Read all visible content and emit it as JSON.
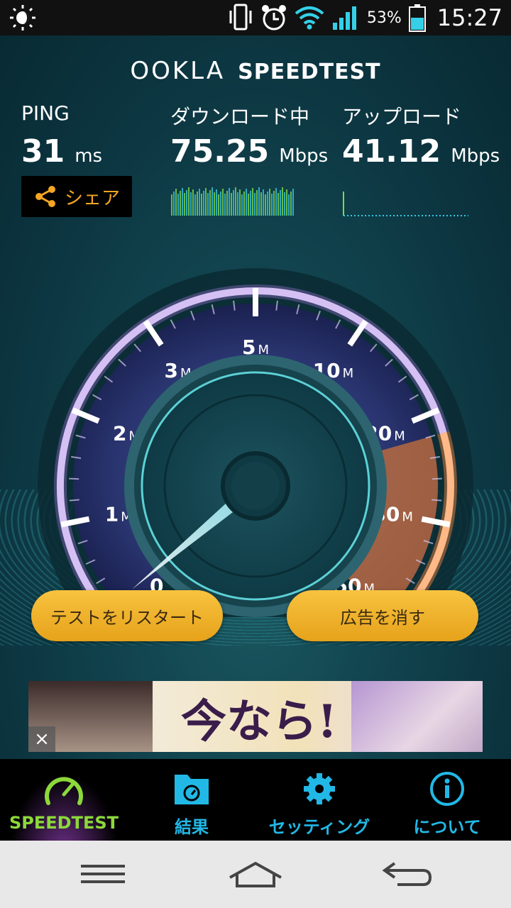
{
  "status_bar": {
    "battery_percent": "53%",
    "time": "15:27",
    "icons": [
      "brightness-icon",
      "vibrate-icon",
      "alarm-icon",
      "wifi-icon",
      "signal-icon",
      "battery-icon"
    ]
  },
  "header": {
    "brand": "OOKLA",
    "product": "SPEEDTEST"
  },
  "ping": {
    "label": "PING",
    "value": "31",
    "unit": "ms"
  },
  "download": {
    "label": "ダウンロード中",
    "value": "75.25",
    "unit": "Mbps"
  },
  "upload": {
    "label": "アップロード",
    "value": "41.12",
    "unit": "Mbps"
  },
  "share": {
    "label": "シェア"
  },
  "gauge": {
    "ticks": [
      {
        "num": "0",
        "unit": ""
      },
      {
        "num": "1",
        "unit": "M"
      },
      {
        "num": "2",
        "unit": "M"
      },
      {
        "num": "3",
        "unit": "M"
      },
      {
        "num": "5",
        "unit": "M"
      },
      {
        "num": "10",
        "unit": "M"
      },
      {
        "num": "20",
        "unit": "M"
      },
      {
        "num": "30",
        "unit": "M"
      },
      {
        "num": "50",
        "unit": "M"
      }
    ]
  },
  "buttons": {
    "restart": "テストをリスタート",
    "remove_ads": "広告を消す"
  },
  "ad": {
    "text": "今なら!",
    "close": "×"
  },
  "bottom_nav": [
    {
      "label": "SPEEDTEST",
      "icon": "speedometer-icon",
      "active": true
    },
    {
      "label": "結果",
      "icon": "results-folder-icon",
      "active": false
    },
    {
      "label": "セッティング",
      "icon": "gear-icon",
      "active": false
    },
    {
      "label": "について",
      "icon": "info-icon",
      "active": false
    }
  ],
  "colors": {
    "accent_green": "#8cd83a",
    "accent_blue": "#22b8e6",
    "button_orange": "#f0b22c",
    "gauge_purple": "#b98ce8",
    "gauge_orange": "#e8893c"
  }
}
